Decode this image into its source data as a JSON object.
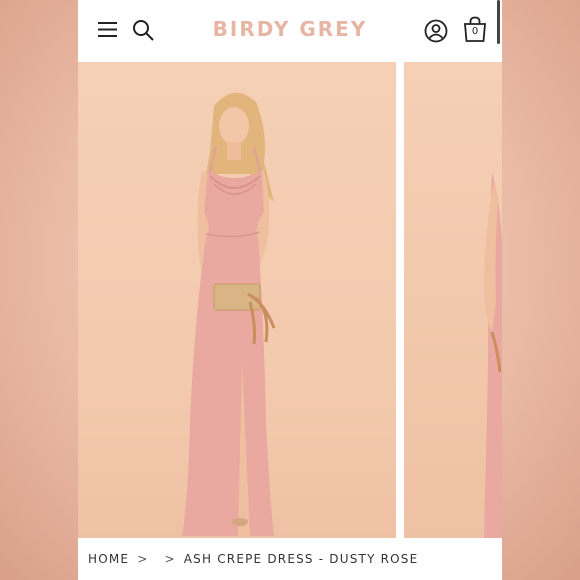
{
  "header": {
    "brand": "BIRDY GREY",
    "cart_count": "0"
  },
  "icons": {
    "menu": "menu-icon",
    "search": "search-icon",
    "account": "account-icon",
    "cart": "cart-icon"
  },
  "breadcrumb": {
    "home": "HOME",
    "sep1": ">",
    "sep2": ">",
    "current": "ASH CREPE DRESS - DUSTY ROSE"
  },
  "colors": {
    "brand": "#e7b5a3",
    "backdrop": "#f3c9ad",
    "dress": "#e9a9a0"
  }
}
